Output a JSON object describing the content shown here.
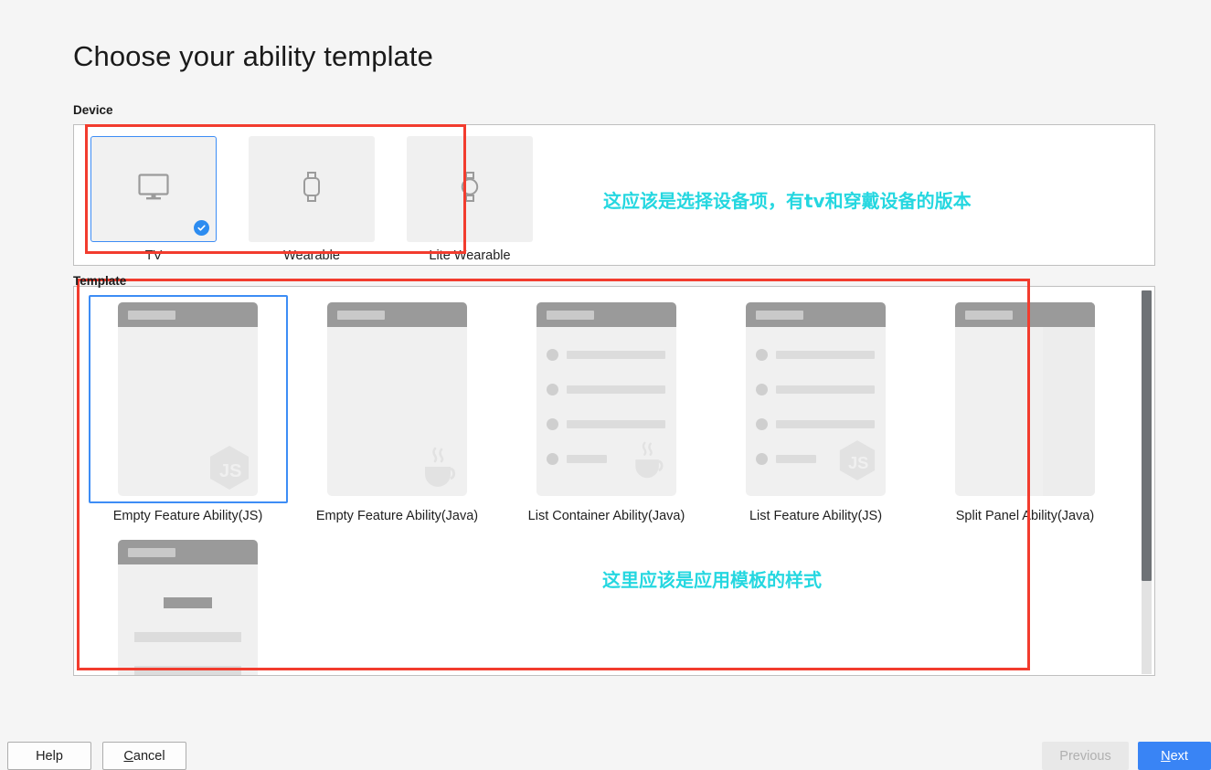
{
  "page": {
    "title": "Choose your ability template"
  },
  "device_section": {
    "label": "Device",
    "items": [
      {
        "name": "TV",
        "icon": "tv-icon",
        "selected": true
      },
      {
        "name": "Wearable",
        "icon": "watch-square-icon",
        "selected": false
      },
      {
        "name": "Lite Wearable",
        "icon": "watch-round-icon",
        "selected": false
      }
    ]
  },
  "template_section": {
    "label": "Template",
    "items": [
      {
        "name": "Empty Feature Ability(JS)",
        "style": "empty",
        "lang": "js",
        "selected": true
      },
      {
        "name": "Empty Feature Ability(Java)",
        "style": "empty",
        "lang": "java",
        "selected": false
      },
      {
        "name": "List Container Ability(Java)",
        "style": "list",
        "lang": "java",
        "selected": false
      },
      {
        "name": "List Feature Ability(JS)",
        "style": "list",
        "lang": "js",
        "selected": false
      },
      {
        "name": "Split Panel Ability(Java)",
        "style": "split",
        "lang": "none",
        "selected": false
      },
      {
        "name": "",
        "style": "centered",
        "lang": "none",
        "selected": false
      }
    ],
    "scrollbar": {
      "name": "vertical-scrollbar"
    }
  },
  "annotations": [
    {
      "text": "这应该是选择设备项，有tv和穿戴设备的版本",
      "color": "#25d7e0"
    },
    {
      "text": "这里应该是应用模板的样式",
      "color": "#25d7e0"
    }
  ],
  "annotation_boxes": {
    "color": "#f23c2e"
  },
  "footer": {
    "help": "Help",
    "cancel_mnemonic": "C",
    "cancel_rest": "ancel",
    "previous": "Previous",
    "next_mnemonic": "N",
    "next_rest": "ext"
  },
  "colors": {
    "accent_blue": "#3984f5",
    "selection_blue": "#3d8df5",
    "check_blue": "#2d8cf0",
    "annotation_red": "#f23c2e",
    "annotation_cyan": "#25d7e0"
  }
}
